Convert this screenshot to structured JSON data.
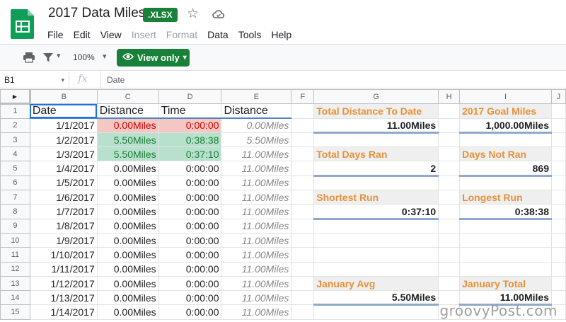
{
  "app": {
    "title": "2017 Data Miles",
    "file_badge": ".XLSX",
    "menu": [
      "File",
      "Edit",
      "View",
      "Insert",
      "Format",
      "Data",
      "Tools",
      "Help"
    ],
    "menu_disabled": [
      "Insert",
      "Format"
    ]
  },
  "toolbar": {
    "zoom": "100%",
    "view_button_label": "View only"
  },
  "formula_bar": {
    "cell_ref": "B1",
    "value": "Date"
  },
  "grid": {
    "columns": [
      "B",
      "C",
      "D",
      "E",
      "F",
      "G",
      "H",
      "I",
      "J"
    ],
    "rows": [
      "1",
      "2",
      "3",
      "4",
      "5",
      "6",
      "7",
      "8",
      "9",
      "10",
      "11",
      "12",
      "13",
      "14",
      "15"
    ],
    "headers": {
      "date": "Date",
      "distance": "Distance",
      "time": "Time",
      "distance2": "Distance"
    },
    "data": [
      {
        "date": "1/1/2017",
        "distance": "0.00Miles",
        "time": "0:00:00",
        "total": "0.00Miles"
      },
      {
        "date": "1/2/2017",
        "distance": "5.50Miles",
        "time": "0:38:38",
        "total": "5.50Miles"
      },
      {
        "date": "1/3/2017",
        "distance": "5.50Miles",
        "time": "0:37:10",
        "total": "11.00Miles"
      },
      {
        "date": "1/4/2017",
        "distance": "0.00Miles",
        "time": "0:00:00",
        "total": "11.00Miles"
      },
      {
        "date": "1/5/2017",
        "distance": "0.00Miles",
        "time": "0:00:00",
        "total": "11.00Miles"
      },
      {
        "date": "1/6/2017",
        "distance": "0.00Miles",
        "time": "0:00:00",
        "total": "11.00Miles"
      },
      {
        "date": "1/7/2017",
        "distance": "0.00Miles",
        "time": "0:00:00",
        "total": "11.00Miles"
      },
      {
        "date": "1/8/2017",
        "distance": "0.00Miles",
        "time": "0:00:00",
        "total": "11.00Miles"
      },
      {
        "date": "1/9/2017",
        "distance": "0.00Miles",
        "time": "0:00:00",
        "total": "11.00Miles"
      },
      {
        "date": "1/10/2017",
        "distance": "0.00Miles",
        "time": "0:00:00",
        "total": "11.00Miles"
      },
      {
        "date": "1/11/2017",
        "distance": "0.00Miles",
        "time": "0:00:00",
        "total": "11.00Miles"
      },
      {
        "date": "1/12/2017",
        "distance": "0.00Miles",
        "time": "0:00:00",
        "total": "11.00Miles"
      },
      {
        "date": "1/13/2017",
        "distance": "0.00Miles",
        "time": "0:00:00",
        "total": "11.00Miles"
      },
      {
        "date": "1/14/2017",
        "distance": "0.00Miles",
        "time": "0:00:00",
        "total": "11.00Miles"
      }
    ],
    "summary": {
      "total_distance_label": "Total Distance To Date",
      "total_distance_value": "11.00Miles",
      "goal_label": "2017 Goal Miles",
      "goal_value": "1,000.00Miles",
      "days_ran_label": "Total Days Ran",
      "days_ran_value": "2",
      "days_not_ran_label": "Days Not Ran",
      "days_not_ran_value": "869",
      "shortest_label": "Shortest Run",
      "shortest_value": "0:37:10",
      "longest_label": "Longest Run",
      "longest_value": "0:38:38",
      "jan_avg_label": "January Avg",
      "jan_avg_value": "5.50Miles",
      "jan_total_label": "January Total",
      "jan_total_value": "11.00Miles"
    }
  },
  "watermark": "groovyPost.com",
  "colors": {
    "brand_green": "#188038",
    "label_orange": "#e69138",
    "highlight_red": "#f4c7c3",
    "highlight_green": "#b7e1cd"
  }
}
